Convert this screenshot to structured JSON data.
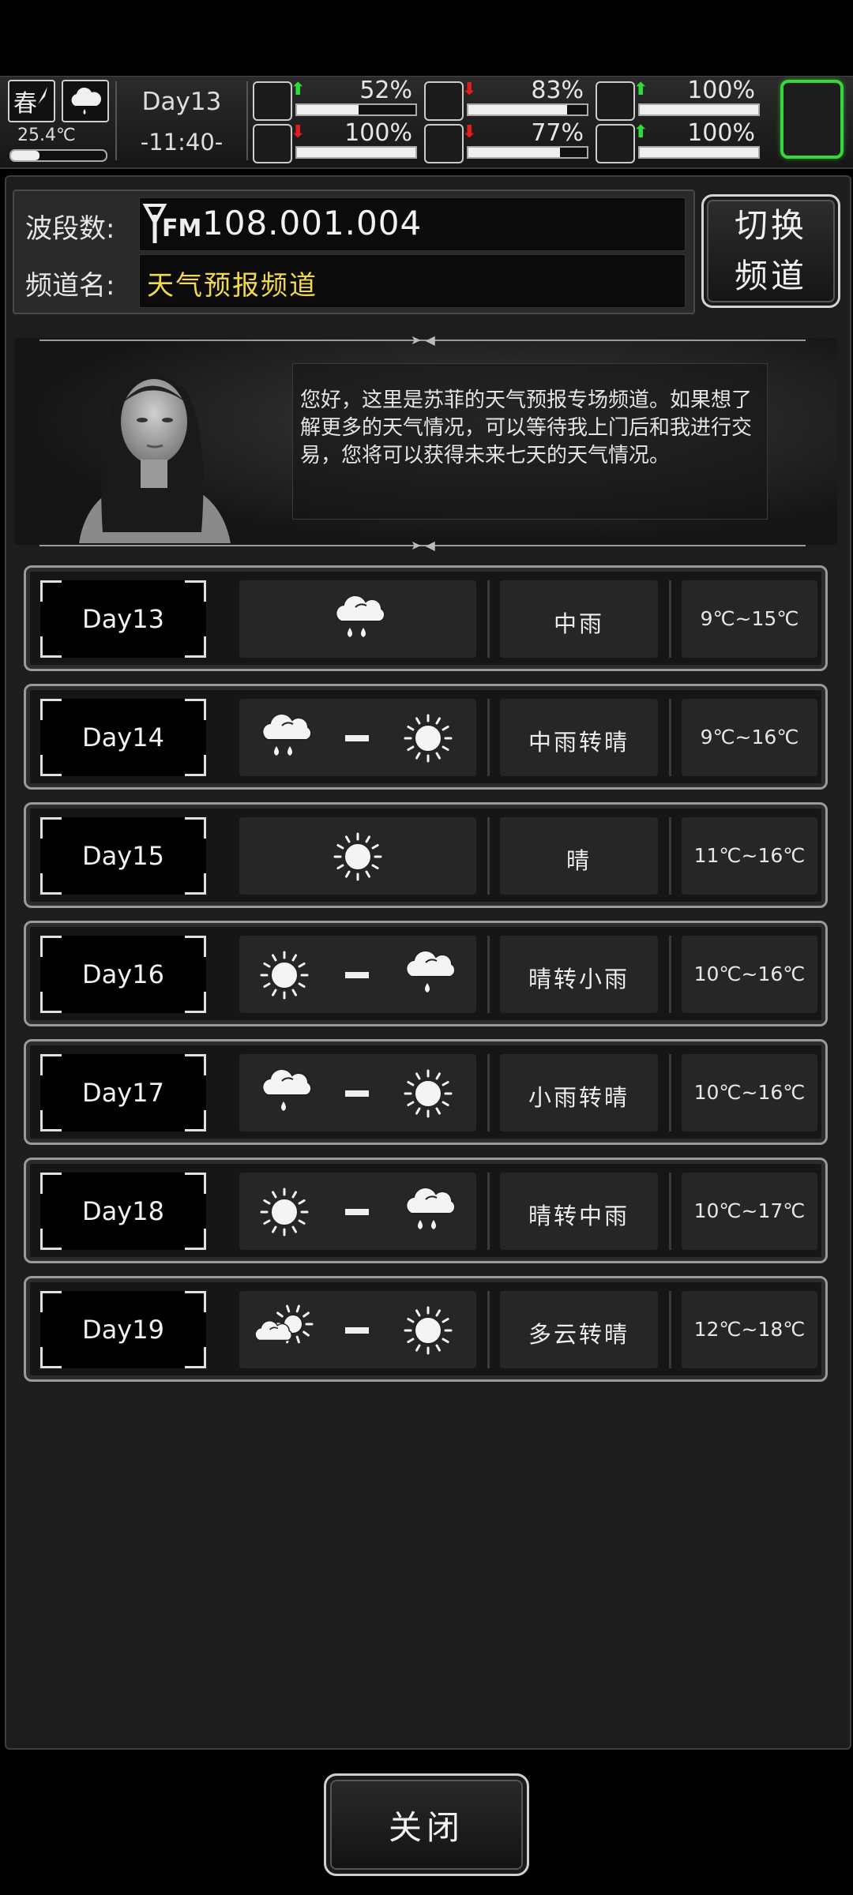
{
  "status": {
    "season": "春",
    "season_icon": "feather-icon",
    "weather_icon": "rain-cloud-icon",
    "temperature": "25.4℃",
    "temperature_level": 0.3,
    "day": "Day13",
    "time": "-11:40-",
    "stats": [
      {
        "name": "health",
        "icon": "medkit-icon",
        "trend": "up",
        "value": "52%",
        "level": 0.52
      },
      {
        "name": "hunger",
        "icon": "stomach-icon",
        "trend": "down",
        "value": "83%",
        "level": 0.83
      },
      {
        "name": "medicine",
        "icon": "pill-icon",
        "trend": "up",
        "value": "100%",
        "level": 1.0
      },
      {
        "name": "stamina",
        "icon": "boot-icon",
        "trend": "down",
        "value": "100%",
        "level": 1.0
      },
      {
        "name": "thirst",
        "icon": "water-drop-icon",
        "trend": "down",
        "value": "77%",
        "level": 0.77
      },
      {
        "name": "mood",
        "icon": "heart-icon",
        "trend": "up",
        "value": "100%",
        "level": 1.0
      }
    ],
    "accent_green": "#37d63a"
  },
  "radio": {
    "frequency_label": "波段数:",
    "frequency_logo": "FM",
    "frequency": "108.001.004",
    "channel_label": "频道名:",
    "channel": "天气预报频道",
    "channel_color": "#f2d84b",
    "switch_line1": "切换",
    "switch_line2": "频道"
  },
  "announcer": {
    "message": "您好，这里是苏菲的天气预报专场频道。如果想了解更多的天气情况，可以等待我上门后和我进行交易，您将可以获得未来七天的天气情况。"
  },
  "forecast": [
    {
      "day": "Day13",
      "icons": [
        "rain-heavy"
      ],
      "desc": "中雨",
      "temp": "9℃~15℃"
    },
    {
      "day": "Day14",
      "icons": [
        "rain-heavy",
        "sun"
      ],
      "desc": "中雨转晴",
      "temp": "9℃~16℃"
    },
    {
      "day": "Day15",
      "icons": [
        "sun"
      ],
      "desc": "晴",
      "temp": "11℃~16℃"
    },
    {
      "day": "Day16",
      "icons": [
        "sun",
        "rain-light"
      ],
      "desc": "晴转小雨",
      "temp": "10℃~16℃"
    },
    {
      "day": "Day17",
      "icons": [
        "rain-light",
        "sun"
      ],
      "desc": "小雨转晴",
      "temp": "10℃~16℃"
    },
    {
      "day": "Day18",
      "icons": [
        "sun",
        "rain-heavy"
      ],
      "desc": "晴转中雨",
      "temp": "10℃~17℃"
    },
    {
      "day": "Day19",
      "icons": [
        "cloudy",
        "sun"
      ],
      "desc": "多云转晴",
      "temp": "12℃~18℃"
    }
  ],
  "close_label": "关闭"
}
